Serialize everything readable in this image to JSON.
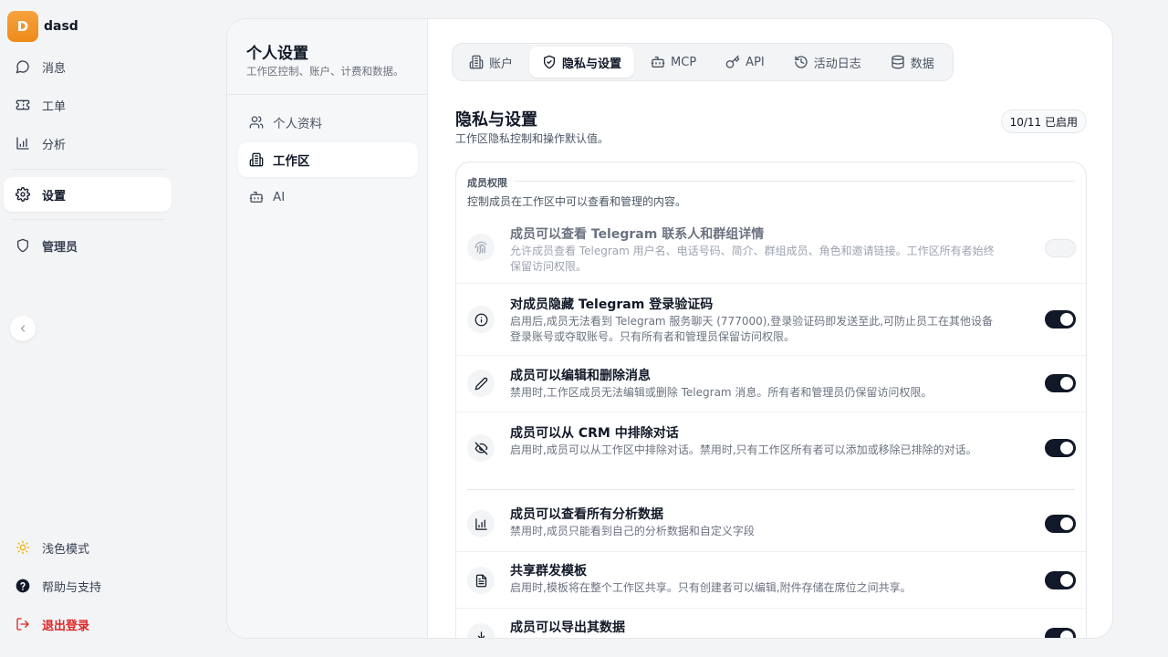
{
  "workspace": {
    "initial": "D",
    "name": "dasd"
  },
  "nav": {
    "items": [
      {
        "label": "消息",
        "icon": "message-icon"
      },
      {
        "label": "工单",
        "icon": "ticket-icon"
      },
      {
        "label": "分析",
        "icon": "chart-icon"
      },
      {
        "label": "设置",
        "icon": "gear-icon"
      },
      {
        "label": "管理员",
        "icon": "shield-icon"
      }
    ],
    "bottom": [
      {
        "label": "浅色模式",
        "icon": "sun-icon"
      },
      {
        "label": "帮助与支持",
        "icon": "help-icon"
      },
      {
        "label": "退出登录",
        "icon": "logout-icon"
      }
    ]
  },
  "settings": {
    "title": "个人设置",
    "description": "工作区控制、账户、计费和数据。",
    "menu": [
      {
        "label": "个人资料",
        "icon": "users-icon"
      },
      {
        "label": "工作区",
        "icon": "building-icon"
      },
      {
        "label": "AI",
        "icon": "bot-icon"
      }
    ]
  },
  "tabs": [
    {
      "label": "账户",
      "icon": "building-icon"
    },
    {
      "label": "隐私与设置",
      "icon": "shield-check-icon"
    },
    {
      "label": "MCP",
      "icon": "bot-icon"
    },
    {
      "label": "API",
      "icon": "key-icon"
    },
    {
      "label": "活动日志",
      "icon": "history-icon"
    },
    {
      "label": "数据",
      "icon": "database-icon"
    }
  ],
  "page": {
    "title": "隐私与设置",
    "description": "工作区隐私控制和操作默认值。",
    "badge": "10/11 已启用"
  },
  "section": {
    "label": "成员权限",
    "description": "控制成员在工作区中可以查看和管理的内容。"
  },
  "rows": [
    {
      "title": "成员可以查看 Telegram 联系人和群组详情",
      "description": "允许成员查看 Telegram 用户名、电话号码、简介、群组成员、角色和邀请链接。工作区所有者始终保留访问权限。",
      "icon": "fingerprint-icon",
      "enabled": false,
      "disabled": true
    },
    {
      "title": "对成员隐藏 Telegram 登录验证码",
      "description": "启用后,成员无法看到 Telegram 服务聊天 (777000),登录验证码即发送至此,可防止员工在其他设备登录账号或夺取账号。只有所有者和管理员保留访问权限。",
      "icon": "info-icon",
      "enabled": true
    },
    {
      "title": "成员可以编辑和删除消息",
      "description": "禁用时,工作区成员无法编辑或删除 Telegram 消息。所有者和管理员仍保留访问权限。",
      "icon": "pencil-icon",
      "enabled": true
    },
    {
      "title": "成员可以从 CRM 中排除对话",
      "description": "启用时,成员可以从工作区中排除对话。禁用时,只有工作区所有者可以添加或移除已排除的对话。",
      "icon": "eye-off-icon",
      "enabled": true
    },
    {
      "title": "成员可以查看所有分析数据",
      "description": "禁用时,成员只能看到自己的分析数据和自定义字段",
      "icon": "chart-icon",
      "enabled": true
    },
    {
      "title": "共享群发模板",
      "description": "启用时,模板将在整个工作区共享。只有创建者可以编辑,附件存储在席位之间共享。",
      "icon": "file-icon",
      "enabled": true
    },
    {
      "title": "成员可以导出其数据",
      "description": "",
      "icon": "download-icon",
      "enabled": true
    }
  ]
}
